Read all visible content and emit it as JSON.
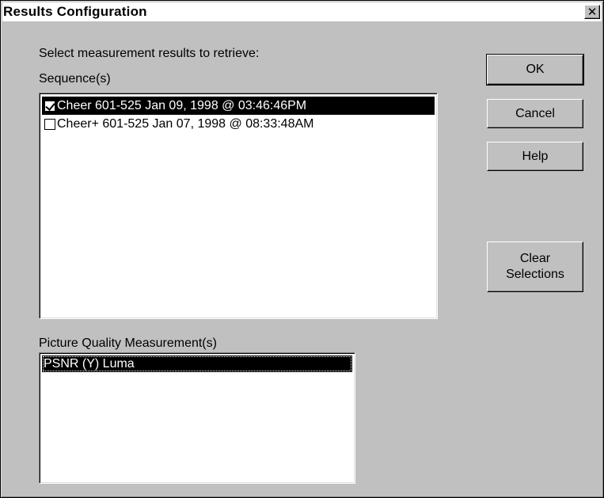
{
  "dialog": {
    "title": "Results Configuration",
    "close_glyph": "✕"
  },
  "labels": {
    "select_prompt": "Select measurement results to retrieve:",
    "sequences": "Sequence(s)",
    "picture_quality": "Picture Quality Measurement(s)"
  },
  "sequences": [
    {
      "label": "Cheer 601-525 Jan 09, 1998 @ 03:46:46PM",
      "checked": true,
      "selected": true
    },
    {
      "label": "Cheer+ 601-525 Jan 07, 1998 @ 08:33:48AM",
      "checked": false,
      "selected": false
    }
  ],
  "measurements": [
    {
      "label": "PSNR (Y) Luma",
      "selected": true
    }
  ],
  "buttons": {
    "ok": "OK",
    "cancel": "Cancel",
    "help": "Help",
    "clear_line1": "Clear",
    "clear_line2": "Selections"
  },
  "colors": {
    "face": "#c0c0c0",
    "selection": "#000000"
  }
}
